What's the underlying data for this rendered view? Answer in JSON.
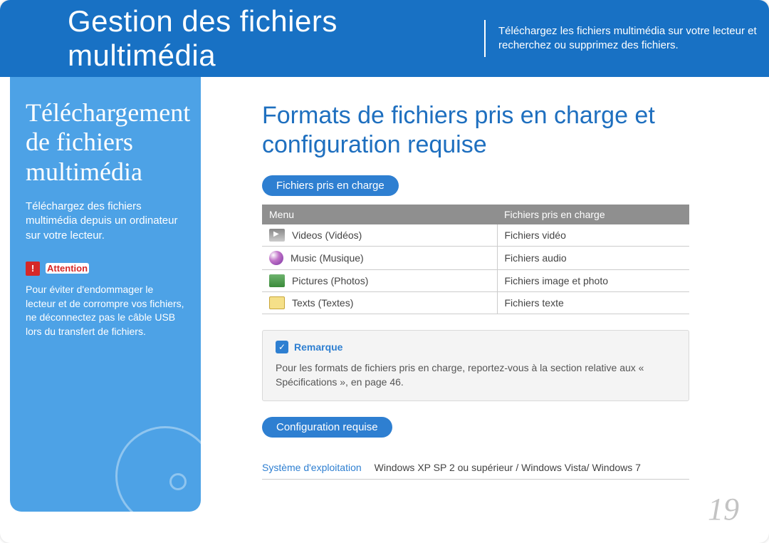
{
  "header": {
    "title": "Gestion des fichiers multimédia",
    "subtitle": "Téléchargez les fichiers multimédia sur votre lecteur et recherchez ou supprimez des fichiers."
  },
  "sidebar": {
    "title": "Téléchargement de fichiers multimédia",
    "desc": "Téléchargez des fichiers multimédia depuis un ordinateur sur votre lecteur.",
    "attention_label": "Attention",
    "attention_text": "Pour éviter d'endommager le lecteur et de corrompre vos fichiers, ne déconnectez pas le câble USB lors du transfert de fichiers."
  },
  "main": {
    "title": "Formats de fichiers pris en charge et configuration requise",
    "pill_files": "Fichiers pris en charge",
    "table_headers": {
      "menu": "Menu",
      "files": "Fichiers pris en charge"
    },
    "rows": [
      {
        "icon": "video-icon",
        "menu": "Videos (Vidéos)",
        "files": "Fichiers vidéo"
      },
      {
        "icon": "music-icon",
        "menu": "Music (Musique)",
        "files": "Fichiers audio"
      },
      {
        "icon": "picture-icon",
        "menu": "Pictures (Photos)",
        "files": "Fichiers image et photo"
      },
      {
        "icon": "text-icon",
        "menu": "Texts (Textes)",
        "files": "Fichiers texte"
      }
    ],
    "note_label": "Remarque",
    "note_body": "Pour les formats de fichiers pris en charge, reportez-vous à la section relative aux « Spécifications », en page 46.",
    "pill_config": "Configuration requise",
    "os_label": "Système d'exploitation",
    "os_value": "Windows XP SP 2 ou supérieur / Windows Vista/ Windows 7"
  },
  "page_number": "19"
}
